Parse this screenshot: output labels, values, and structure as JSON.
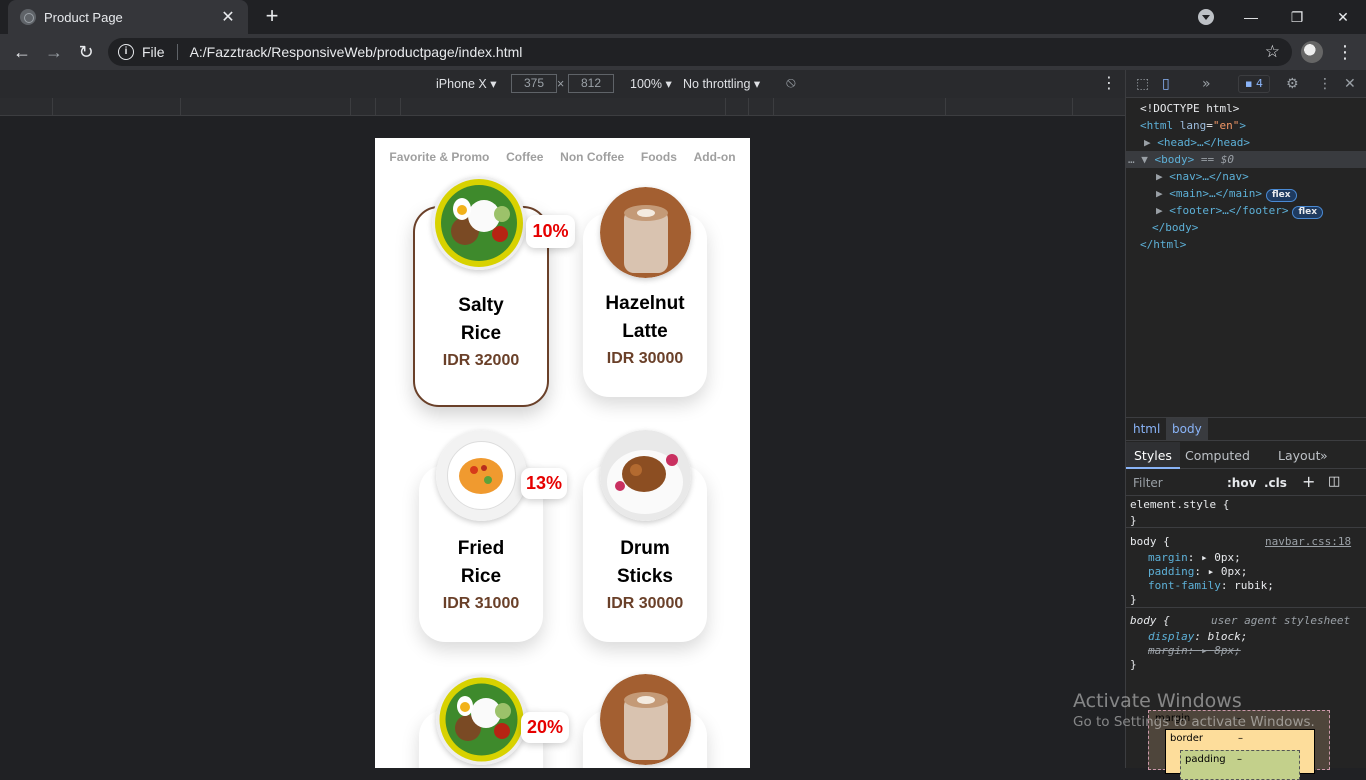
{
  "browser": {
    "tab_title": "Product Page",
    "tab_close": "✕",
    "new_tab": "+",
    "url_scheme_label": "File",
    "url": "A:/Fazztrack/ResponsiveWeb/productpage/index.html",
    "window_controls": {
      "minimize": "—",
      "restore": "❐",
      "close": "✕"
    }
  },
  "device_toolbar": {
    "device": "iPhone X",
    "width": "375",
    "height": "812",
    "times": "×",
    "zoom": "100%",
    "throttling": "No throttling"
  },
  "page": {
    "nav": [
      "Favorite & Promo",
      "Coffee",
      "Non Coffee",
      "Foods",
      "Add-on"
    ],
    "products": [
      {
        "name_line1": "Salty",
        "name_line2": "Rice",
        "price": "IDR 32000",
        "discount": "10%",
        "image": "nasi-lemak"
      },
      {
        "name_line1": "Hazelnut",
        "name_line2": "Latte",
        "price": "IDR 30000",
        "discount": "",
        "image": "latte"
      },
      {
        "name_line1": "Fried",
        "name_line2": "Rice",
        "price": "IDR 31000",
        "discount": "13%",
        "image": "fried-noodles"
      },
      {
        "name_line1": "Drum",
        "name_line2": "Sticks",
        "price": "IDR 30000",
        "discount": "",
        "image": "drum-sticks"
      },
      {
        "name_line1": "",
        "name_line2": "",
        "price": "",
        "discount": "20%",
        "image": "nasi-lemak"
      },
      {
        "name_line1": "",
        "name_line2": "",
        "price": "",
        "discount": "",
        "image": "latte"
      }
    ]
  },
  "devtools": {
    "issues_count": "4",
    "dom": {
      "doctype": "<!DOCTYPE html>",
      "html_open_tag": "<html",
      "html_attr": "lang",
      "html_attr_val": "\"en\"",
      "head": "<head>…</head>",
      "body_open": "<body>",
      "body_eq": "== $0",
      "nav": "<nav>…</nav>",
      "main": "<main>…</main>",
      "footer": "<footer>…</footer>",
      "body_close": "</body>",
      "html_close": "</html>",
      "flex_label": "flex"
    },
    "breadcrumbs": [
      "html",
      "body"
    ],
    "tabs": [
      "Styles",
      "Computed",
      "Layout"
    ],
    "filter_placeholder": "Filter",
    "hov": ":hov",
    "cls": ".cls",
    "styles": {
      "element_style": "element.style {",
      "close_brace": "}",
      "body_selector": "body {",
      "body_source": "navbar.css:18",
      "rules": [
        {
          "prop": "margin",
          "value": "0px;"
        },
        {
          "prop": "padding",
          "value": "0px;"
        },
        {
          "prop": "font-family",
          "value": "rubik;"
        }
      ],
      "ua_selector": "body {",
      "ua_source": "user agent stylesheet",
      "ua_rules": [
        {
          "prop": "display",
          "value": "block;"
        },
        {
          "prop": "margin",
          "value": "8px;"
        }
      ]
    },
    "box_model": {
      "margin": "margin",
      "border": "border",
      "padding": "padding",
      "dash": "–"
    }
  },
  "os": {
    "watermark_line1": "Activate Windows",
    "watermark_line2": "Go to Settings to activate Windows."
  }
}
